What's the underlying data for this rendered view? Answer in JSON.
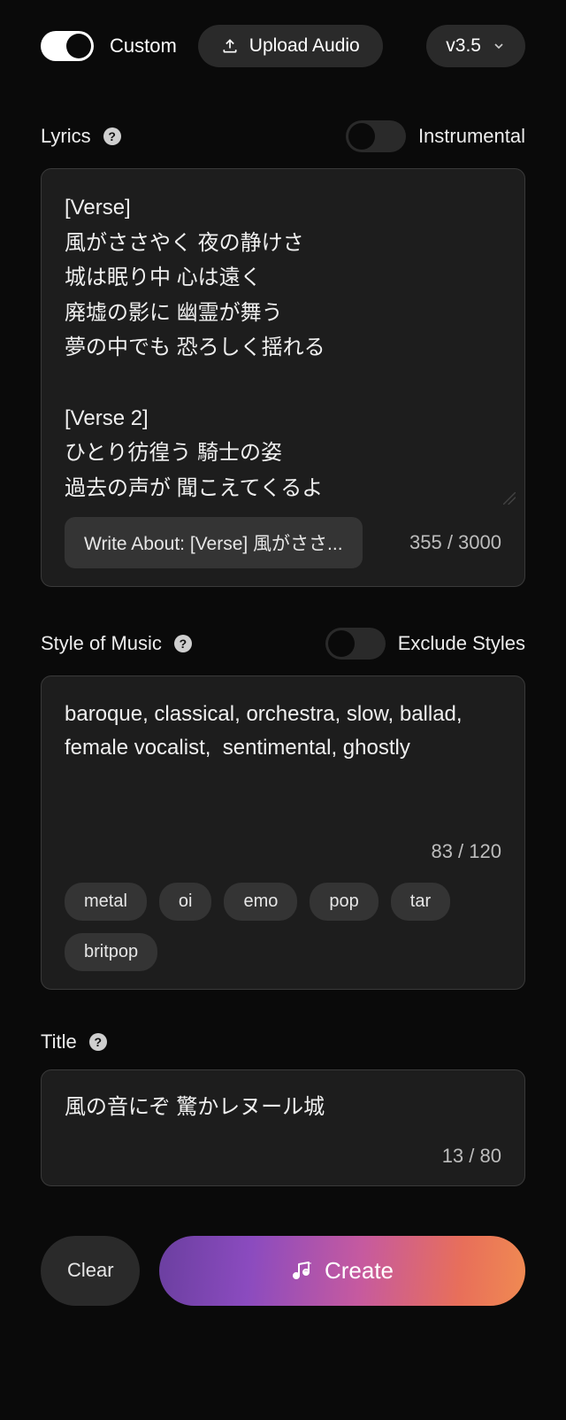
{
  "topbar": {
    "custom_label": "Custom",
    "custom_on": true,
    "upload_label": "Upload Audio",
    "version_label": "v3.5"
  },
  "lyrics": {
    "label": "Lyrics",
    "instrumental_label": "Instrumental",
    "instrumental_on": false,
    "text": "[Verse]\n風がささやく 夜の静けさ\n城は眠り中 心は遠く\n廃墟の影に 幽霊が舞う\n夢の中でも 恐ろしく揺れる\n\n[Verse 2]\nひとり彷徨う 騎士の姿\n過去の声が 聞こえてくるよ\n古びた壁に 物語描く",
    "write_about_label": "Write About: [Verse] 風がささ...",
    "count": "355",
    "max": "3000"
  },
  "style": {
    "label": "Style of Music",
    "exclude_label": "Exclude Styles",
    "exclude_on": false,
    "text": "baroque, classical, orchestra, slow, ballad, female vocalist,  sentimental, ghostly",
    "count": "83",
    "max": "120",
    "suggestions": [
      "metal",
      "oi",
      "emo",
      "pop",
      "tar",
      "britpop"
    ]
  },
  "title": {
    "label": "Title",
    "text": "風の音にぞ 驚かレヌール城",
    "count": "13",
    "max": "80"
  },
  "actions": {
    "clear": "Clear",
    "create": "Create"
  }
}
